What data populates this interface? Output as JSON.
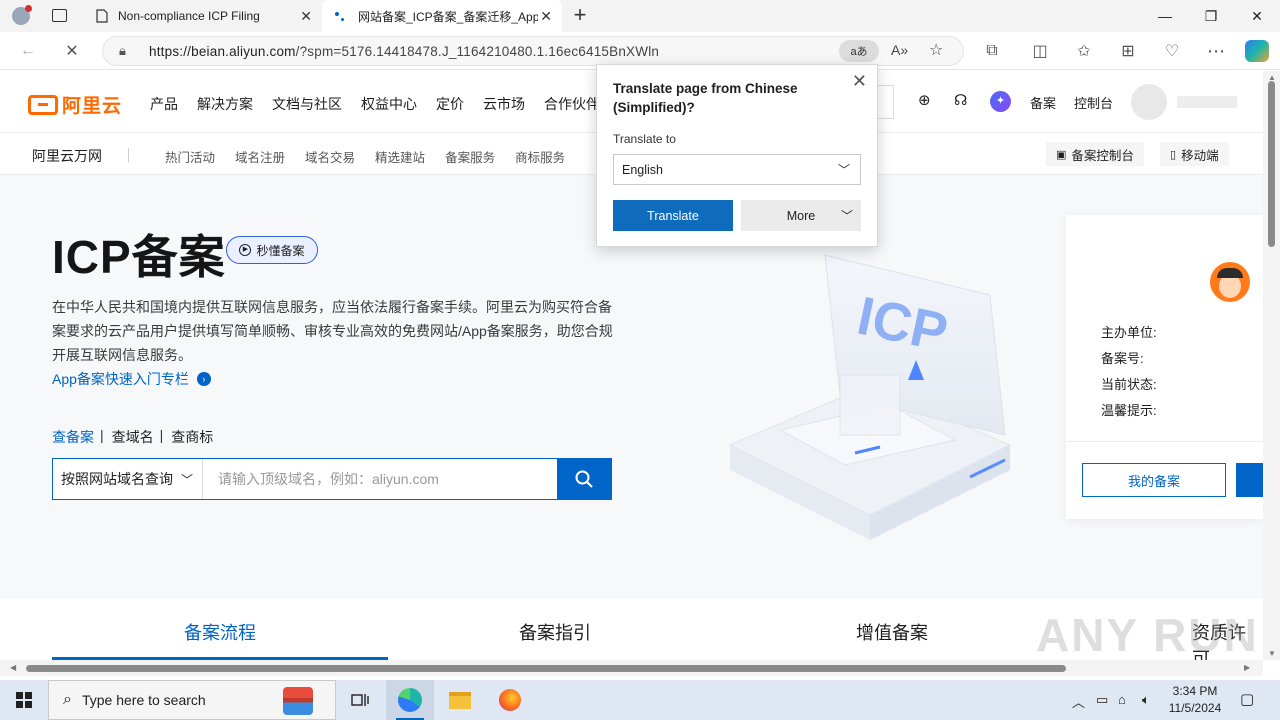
{
  "browser": {
    "tabs": [
      {
        "title": "Non-compliance ICP Filing",
        "active": false
      },
      {
        "title": "网站备案_ICP备案_备案迁移_App",
        "active": true
      }
    ],
    "new_tab": "+",
    "url_host": "https://beian.aliyun.com",
    "url_rest": "/?spm=5176.14418478.J_1164210480.1.16ec6415BnXWln",
    "translate_pill": "aあ"
  },
  "site": {
    "logo_text": "阿里云",
    "nav": [
      "产品",
      "解决方案",
      "文档与社区",
      "权益中心",
      "定价",
      "云市场",
      "合作伙伴"
    ],
    "header_right": {
      "beian": "备案",
      "console": "控制台"
    },
    "sub_brand": "阿里云万网",
    "sub_links": [
      "热门活动",
      "域名注册",
      "域名交易",
      "精选建站",
      "备案服务",
      "商标服务"
    ],
    "sub_buttons": {
      "console": "备案控制台",
      "mobile": "移动端"
    }
  },
  "hero": {
    "title": "ICP备案",
    "pill": "秒懂备案",
    "desc": "在中华人民共和国境内提供互联网信息服务，应当依法履行备案手续。阿里云为购买符合备案要求的云产品用户提供填写简单顺畅、审核专业高效的免费网站/App备案服务，助您合规开展互联网信息服务。",
    "link": "App备案快速入门专栏",
    "query_tabs": [
      "查备案",
      "查域名",
      "查商标"
    ],
    "search_select": "按照网站域名查询",
    "search_placeholder": "请输入顶级域名，例如：aliyun.com"
  },
  "side_card": {
    "labels": [
      "主办单位:",
      "备案号:",
      "当前状态:",
      "温馨提示:"
    ],
    "my_beian": "我的备案"
  },
  "bottom_tabs": [
    "备案流程",
    "备案指引",
    "增值备案",
    "资质许可"
  ],
  "translate_popup": {
    "title": "Translate page from Chinese (Simplified)?",
    "to_label": "Translate to",
    "language": "English",
    "translate_btn": "Translate",
    "more_btn": "More"
  },
  "watermark": "ANY RUN",
  "taskbar": {
    "search_placeholder": "Type here to search",
    "time": "3:34 PM",
    "date": "11/5/2024"
  },
  "colors": {
    "brand": "#ff6a00",
    "primary": "#0064c8",
    "edge_blue": "#0f6cbd"
  }
}
